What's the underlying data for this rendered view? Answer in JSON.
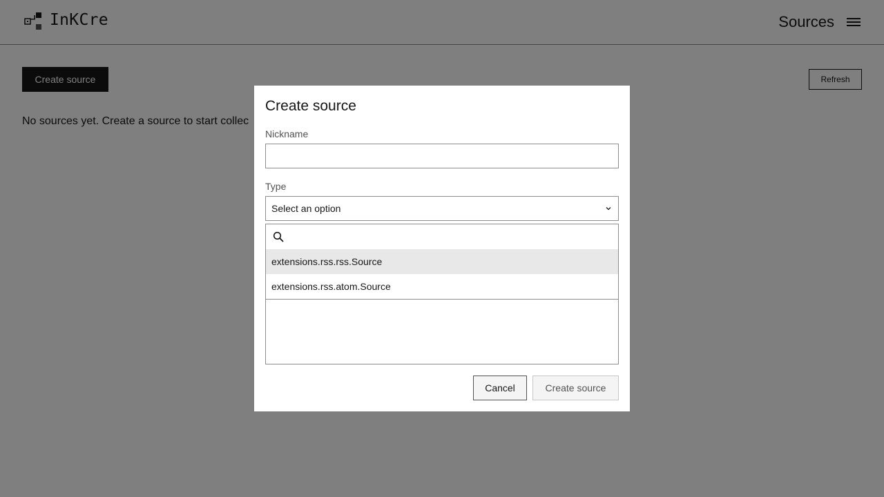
{
  "header": {
    "app_title": "InKCre",
    "nav_title": "Sources"
  },
  "toolbar": {
    "create_label": "Create source",
    "refresh_label": "Refresh"
  },
  "main": {
    "empty_message": "No sources yet. Create a source to start collec"
  },
  "modal": {
    "title": "Create source",
    "nickname_label": "Nickname",
    "nickname_value": "",
    "type_label": "Type",
    "type_selected": "Select an option",
    "search_value": "",
    "options": [
      {
        "label": "extensions.rss.rss.Source"
      },
      {
        "label": "extensions.rss.atom.Source"
      }
    ],
    "cancel_label": "Cancel",
    "submit_label": "Create source"
  },
  "colors": {
    "primary": "#161616",
    "overlay": "rgba(0,0,0,0.5)",
    "option_hover": "#e8e8e8"
  },
  "icons": {
    "logo": "logo-icon",
    "menu": "hamburger-menu-icon",
    "chevron": "chevron-down-icon",
    "search": "search-icon"
  }
}
